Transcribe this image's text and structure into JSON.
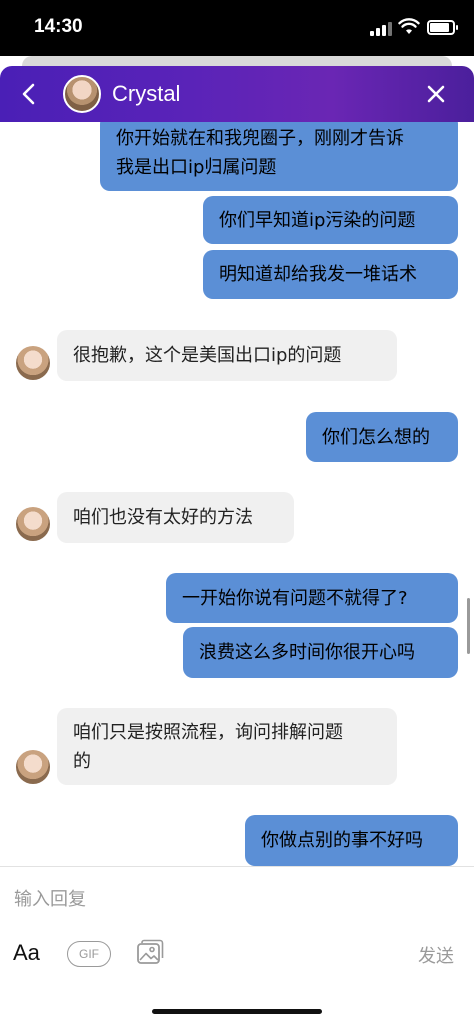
{
  "status_bar": {
    "time": "14:30",
    "battery_level": 0.85
  },
  "header": {
    "contact_name": "Crystal",
    "back_icon": "chevron-left-icon",
    "close_icon": "close-icon"
  },
  "messages": [
    {
      "direction": "outgoing",
      "text": "你开始就在和我兜圈子，刚刚才告诉\n我是出口ip归属问题"
    },
    {
      "direction": "outgoing",
      "text": "你们早知道ip污染的问题"
    },
    {
      "direction": "outgoing",
      "text": "明知道却给我发一堆话术"
    },
    {
      "direction": "incoming",
      "text": "很抱歉，这个是美国出口ip的问题"
    },
    {
      "direction": "outgoing",
      "text": "你们怎么想的"
    },
    {
      "direction": "incoming",
      "text": "咱们也没有太好的方法"
    },
    {
      "direction": "outgoing",
      "text": "一开始你说有问题不就得了?"
    },
    {
      "direction": "outgoing",
      "text": "浪费这么多时间你很开心吗"
    },
    {
      "direction": "incoming",
      "text": "咱们只是按照流程，询问排解问题\n的"
    },
    {
      "direction": "outgoing",
      "text": "你做点别的事不好吗"
    }
  ],
  "composer": {
    "placeholder": "输入回复",
    "font_button": "Aa",
    "gif_button": "GIF",
    "image_icon": "image-icon",
    "send_label": "发送"
  },
  "colors": {
    "header_gradient_start": "#4a1fb6",
    "header_gradient_end": "#6a26b4",
    "outgoing_bubble": "#5b8fd6",
    "incoming_bubble": "#f0f0f0",
    "muted_text": "#9a9a9a"
  }
}
